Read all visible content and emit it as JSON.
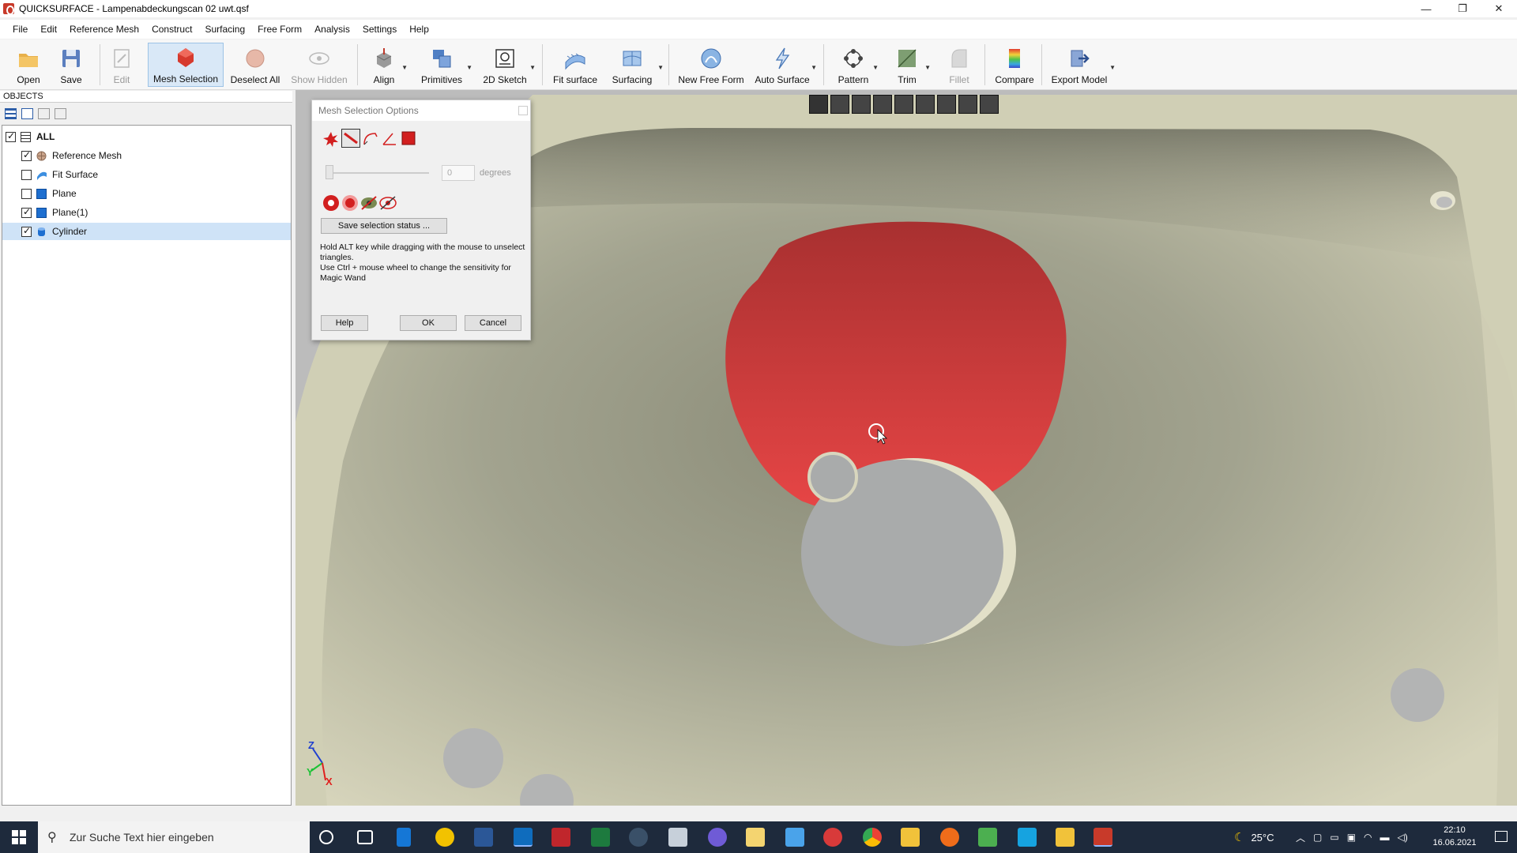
{
  "window": {
    "title": "QUICKSURFACE - Lampenabdeckungscan 02 uwt.qsf",
    "controls": [
      "—",
      "❐",
      "✕"
    ]
  },
  "menu": [
    "File",
    "Edit",
    "Reference Mesh",
    "Construct",
    "Surfacing",
    "Free Form",
    "Analysis",
    "Settings",
    "Help"
  ],
  "toolbar": {
    "open": "Open",
    "save": "Save",
    "edit": "Edit",
    "mesh_selection": "Mesh Selection",
    "deselect_all": "Deselect All",
    "show_hidden": "Show Hidden",
    "align": "Align",
    "primitives": "Primitives",
    "sketch_2d": "2D Sketch",
    "fit_surface": "Fit surface",
    "surfacing": "Surfacing",
    "new_free_form": "New Free Form",
    "auto_surface": "Auto Surface",
    "pattern": "Pattern",
    "trim": "Trim",
    "fillet": "Fillet",
    "compare": "Compare",
    "export_model": "Export Model"
  },
  "objects_panel": {
    "header": "OBJECTS",
    "root": "ALL",
    "items": [
      {
        "label": "Reference Mesh",
        "checked": true,
        "icon": "mesh-icon"
      },
      {
        "label": "Fit Surface",
        "checked": false,
        "icon": "surface-icon"
      },
      {
        "label": "Plane",
        "checked": false,
        "icon": "plane-icon"
      },
      {
        "label": "Plane(1)",
        "checked": true,
        "icon": "plane-icon"
      },
      {
        "label": "Cylinder",
        "checked": true,
        "icon": "cylinder-icon",
        "selected": true
      }
    ]
  },
  "dialog": {
    "title": "Mesh Selection Options",
    "angle_value": "0",
    "angle_unit": "degrees",
    "save_status": "Save selection status ...",
    "help_line1": "Hold ALT key while dragging with the mouse to unselect triangles.",
    "help_line2": "Use Ctrl + mouse wheel to change the sensitivity for Magic Wand",
    "help": "Help",
    "ok": "OK",
    "cancel": "Cancel"
  },
  "viewport": {
    "axes": {
      "z": "Z",
      "y": "Y",
      "x": "X"
    },
    "colors": {
      "mesh": "#c9c8b0",
      "selection": "#dc3c3c",
      "background": "#bcbcbc"
    }
  },
  "taskbar": {
    "search_placeholder": "Zur Suche Text hier eingeben",
    "temperature": "25°C",
    "time": "22:10",
    "date": "16.06.2021"
  }
}
